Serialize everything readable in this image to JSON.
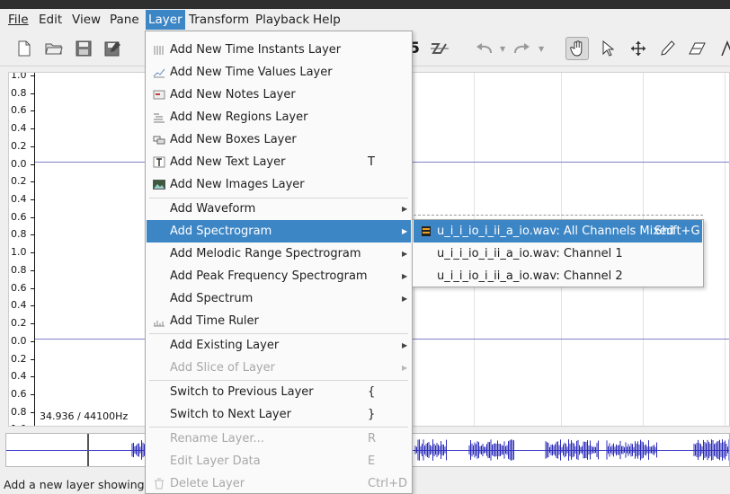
{
  "menubar": {
    "file": "File",
    "edit": "Edit",
    "view": "View",
    "pane": "Pane",
    "layer": "Layer",
    "transform": "Transform",
    "playback": "Playback",
    "help": "Help"
  },
  "toolbar": {
    "icons": [
      "new-file-icon",
      "open-folder-icon",
      "save-icon",
      "save-as-icon",
      "undo-icon",
      "redo-icon",
      "navigate-hand-icon",
      "select-arrow-icon",
      "move-cross-icon",
      "draw-pencil-icon",
      "erase-icon",
      "measure-icon"
    ]
  },
  "canvas": {
    "scale_labels": [
      "1.0",
      "0.8",
      "0.6",
      "0.4",
      "0.2",
      "0.0",
      "0.2",
      "0.4",
      "0.6",
      "0.8",
      "1.0",
      "0.8",
      "0.6",
      "0.4",
      "0.2",
      "0.0",
      "0.2",
      "0.4",
      "0.6",
      "0.8",
      "1.0"
    ],
    "rate_text": "34.936 / 44100Hz",
    "waveform_color": "#8080c8"
  },
  "layer_menu": {
    "items": [
      {
        "label": "Add New Time Instants Layer",
        "shortcut": ""
      },
      {
        "label": "Add New Time Values Layer",
        "shortcut": ""
      },
      {
        "label": "Add New Notes Layer",
        "shortcut": ""
      },
      {
        "label": "Add New Regions Layer",
        "shortcut": ""
      },
      {
        "label": "Add New Boxes Layer",
        "shortcut": ""
      },
      {
        "label": "Add New Text Layer",
        "shortcut": "T"
      },
      {
        "label": "Add New Images Layer",
        "shortcut": ""
      },
      {
        "label": "Add Waveform",
        "shortcut": ""
      },
      {
        "label": "Add Spectrogram",
        "shortcut": ""
      },
      {
        "label": "Add Melodic Range Spectrogram",
        "shortcut": ""
      },
      {
        "label": "Add Peak Frequency Spectrogram",
        "shortcut": ""
      },
      {
        "label": "Add Spectrum",
        "shortcut": ""
      },
      {
        "label": "Add Time Ruler",
        "shortcut": ""
      },
      {
        "label": "Add Existing Layer",
        "shortcut": ""
      },
      {
        "label": "Add Slice of Layer",
        "shortcut": ""
      },
      {
        "label": "Switch to Previous Layer",
        "shortcut": "{"
      },
      {
        "label": "Switch to Next Layer",
        "shortcut": "}"
      },
      {
        "label": "Rename Layer...",
        "shortcut": "R"
      },
      {
        "label": "Edit Layer Data",
        "shortcut": "E"
      },
      {
        "label": "Delete Layer",
        "shortcut": "Ctrl+D"
      }
    ]
  },
  "spectrogram_submenu": {
    "items": [
      {
        "label": "u_i_i_io_i_ii_a_io.wav: All Channels Mixed",
        "shortcut": "Shift+G"
      },
      {
        "label": "u_i_i_io_i_ii_a_io.wav: Channel 1",
        "shortcut": ""
      },
      {
        "label": "u_i_i_io_i_ii_a_io.wav: Channel 2",
        "shortcut": ""
      }
    ]
  },
  "statusbar": {
    "text": "Add a new layer showing a s"
  },
  "colors": {
    "highlight": "#3d86c6",
    "waveform": "#2a2ab8"
  }
}
